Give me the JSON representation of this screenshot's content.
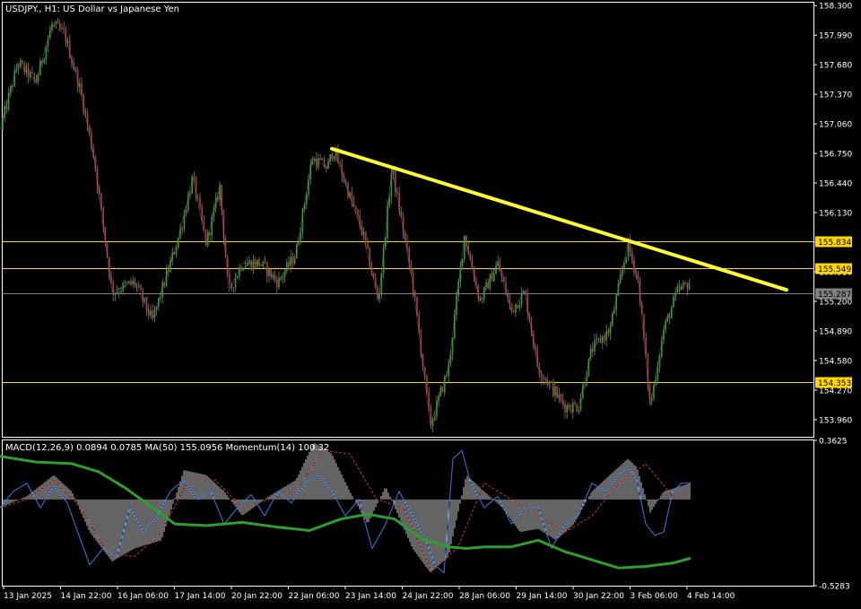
{
  "colors": {
    "background": "#000000",
    "frame": "#ffffff",
    "text": "#ffffff",
    "bull_candle": "#2e9d2e",
    "bear_candle": "#b23a3a",
    "wick": "#8c8c8c",
    "level_line": "#ffd700",
    "current_line": "#7f7f7f",
    "trendline": "#ffff33",
    "macd_hist": "#c8c8c8",
    "macd_signal": "#c83232",
    "ma_line": "#2f9e2f",
    "momentum_line": "#3b7be0",
    "label_text_dark": "#000000"
  },
  "chart_data": [
    {
      "type": "candlestick",
      "title": "USDJPY., H1:  US Dollar vs Japanese Yen",
      "ylim": [
        153.78,
        158.33
      ],
      "y_ticks": [
        "158.300",
        "157.990",
        "157.680",
        "157.370",
        "157.060",
        "156.750",
        "156.440",
        "156.130",
        "155.820",
        "155.510",
        "155.200",
        "154.890",
        "154.580",
        "154.270",
        "153.960"
      ],
      "horizontal_levels": [
        {
          "value": 155.834,
          "label": "155.834",
          "style": "gold"
        },
        {
          "value": 155.549,
          "label": "155.549",
          "style": "gold"
        },
        {
          "value": 155.287,
          "label": "155.287",
          "style": "current"
        },
        {
          "value": 154.353,
          "label": "154.353",
          "style": "gold"
        }
      ],
      "trendline": {
        "start": {
          "bar": 370,
          "price": 156.8
        },
        "end": {
          "bar": 877,
          "price": 155.32
        }
      },
      "series": [
        {
          "name": "price_path",
          "x": [
            0,
            20,
            40,
            58,
            72,
            90,
            105,
            125,
            150,
            170,
            200,
            215,
            230,
            245,
            255,
            270,
            290,
            310,
            330,
            348,
            365,
            372,
            390,
            405,
            422,
            437,
            460,
            480,
            500,
            518,
            535,
            555,
            570,
            585,
            600,
            615,
            630,
            645,
            660,
            680,
            700,
            712,
            725,
            740,
            755,
            770
          ],
          "values": [
            157.0,
            157.7,
            157.5,
            158.1,
            158.0,
            157.4,
            156.7,
            155.3,
            155.4,
            155.0,
            155.9,
            156.5,
            155.8,
            156.4,
            155.3,
            155.6,
            155.6,
            155.4,
            155.7,
            156.7,
            156.6,
            156.8,
            156.3,
            155.9,
            155.2,
            156.6,
            155.4,
            153.9,
            154.5,
            155.9,
            155.2,
            155.6,
            155.1,
            155.3,
            154.5,
            154.3,
            154.1,
            154.1,
            154.7,
            154.9,
            155.8,
            155.4,
            154.1,
            154.9,
            155.3,
            155.4
          ]
        }
      ],
      "x_ticks": [
        "13 Jan 2025",
        "14 Jan 22:00",
        "16 Jan 06:00",
        "17 Jan 14:00",
        "20 Jan 22:00",
        "22 Jan 06:00",
        "23 Jan 14:00",
        "24 Jan 22:00",
        "28 Jan 06:00",
        "29 Jan 14:00",
        "30 Jan 22:00",
        "3 Feb 06:00",
        "4 Feb 14:00"
      ]
    },
    {
      "type": "line",
      "title": "MACD(12,26,9) 0.0894 0.0785 MA(50) 155.0956 Momentum(14) 100.32",
      "ylim": [
        -0.5283,
        0.3625
      ],
      "y_ticks": [
        "0.3625",
        "-0.5283"
      ],
      "series": [
        {
          "name": "histogram",
          "style": "bars",
          "x": [
            0,
            30,
            60,
            80,
            100,
            125,
            150,
            180,
            205,
            230,
            250,
            270,
            300,
            330,
            350,
            370,
            390,
            410,
            430,
            460,
            480,
            500,
            520,
            540,
            560,
            580,
            600,
            620,
            640,
            660,
            680,
            700,
            710,
            725,
            740,
            770
          ],
          "values": [
            -0.05,
            0.02,
            0.15,
            0.05,
            -0.2,
            -0.38,
            -0.3,
            -0.25,
            0.18,
            0.15,
            0.05,
            -0.1,
            0.02,
            0.12,
            0.35,
            0.28,
            0.05,
            -0.15,
            0.08,
            -0.3,
            -0.45,
            -0.35,
            0.15,
            0.05,
            -0.05,
            -0.2,
            -0.18,
            -0.25,
            -0.15,
            0.05,
            0.15,
            0.25,
            0.2,
            -0.08,
            0.05,
            0.1
          ]
        },
        {
          "name": "signal",
          "style": "dashed",
          "x": [
            0,
            30,
            60,
            90,
            120,
            150,
            180,
            210,
            240,
            270,
            300,
            330,
            360,
            390,
            420,
            450,
            480,
            510,
            540,
            570,
            600,
            630,
            660,
            690,
            720,
            750,
            770
          ],
          "values": [
            -0.05,
            0.0,
            0.12,
            -0.05,
            -0.33,
            -0.35,
            -0.2,
            0.12,
            0.12,
            -0.05,
            0.0,
            0.05,
            0.3,
            0.28,
            0.0,
            -0.05,
            -0.43,
            -0.3,
            0.1,
            0.0,
            -0.1,
            -0.2,
            -0.1,
            0.1,
            0.22,
            0.02,
            0.05
          ]
        },
        {
          "name": "MA(50)",
          "style": "solid-thick",
          "x": [
            0,
            40,
            80,
            110,
            140,
            170,
            195,
            230,
            270,
            310,
            345,
            380,
            410,
            440,
            470,
            500,
            520,
            540,
            570,
            600,
            630,
            660,
            690,
            720,
            750,
            770
          ],
          "values": [
            0.265,
            0.23,
            0.22,
            0.17,
            0.07,
            -0.05,
            -0.15,
            -0.16,
            -0.14,
            -0.17,
            -0.19,
            -0.12,
            -0.09,
            -0.12,
            -0.24,
            -0.29,
            -0.3,
            -0.29,
            -0.29,
            -0.25,
            -0.32,
            -0.37,
            -0.42,
            -0.41,
            -0.39,
            -0.36
          ]
        },
        {
          "name": "Momentum(14)",
          "style": "solid-thin",
          "x": [
            0,
            15,
            30,
            45,
            60,
            75,
            90,
            100,
            115,
            130,
            145,
            160,
            175,
            190,
            205,
            220,
            235,
            250,
            265,
            280,
            295,
            310,
            325,
            340,
            355,
            370,
            385,
            400,
            415,
            430,
            445,
            460,
            475,
            485,
            495,
            505,
            515,
            525,
            540,
            555,
            570,
            585,
            600,
            615,
            630,
            645,
            660,
            675,
            690,
            700,
            710,
            720,
            730,
            740,
            750,
            760,
            770
          ],
          "values": [
            -0.05,
            0.05,
            0.1,
            -0.05,
            0.08,
            -0.02,
            -0.25,
            -0.4,
            -0.3,
            -0.35,
            -0.05,
            -0.2,
            -0.1,
            0.05,
            0.12,
            0.0,
            0.05,
            -0.15,
            -0.05,
            0.03,
            -0.1,
            0.05,
            -0.02,
            0.1,
            0.15,
            0.05,
            -0.1,
            0.0,
            -0.3,
            -0.15,
            0.05,
            -0.1,
            -0.25,
            -0.4,
            -0.45,
            0.25,
            0.3,
            0.1,
            -0.05,
            0.02,
            -0.15,
            -0.05,
            -0.05,
            -0.3,
            -0.15,
            -0.1,
            0.1,
            0.05,
            0.15,
            0.2,
            0.12,
            -0.15,
            -0.22,
            -0.2,
            0.05,
            0.1,
            0.1
          ]
        }
      ]
    }
  ]
}
